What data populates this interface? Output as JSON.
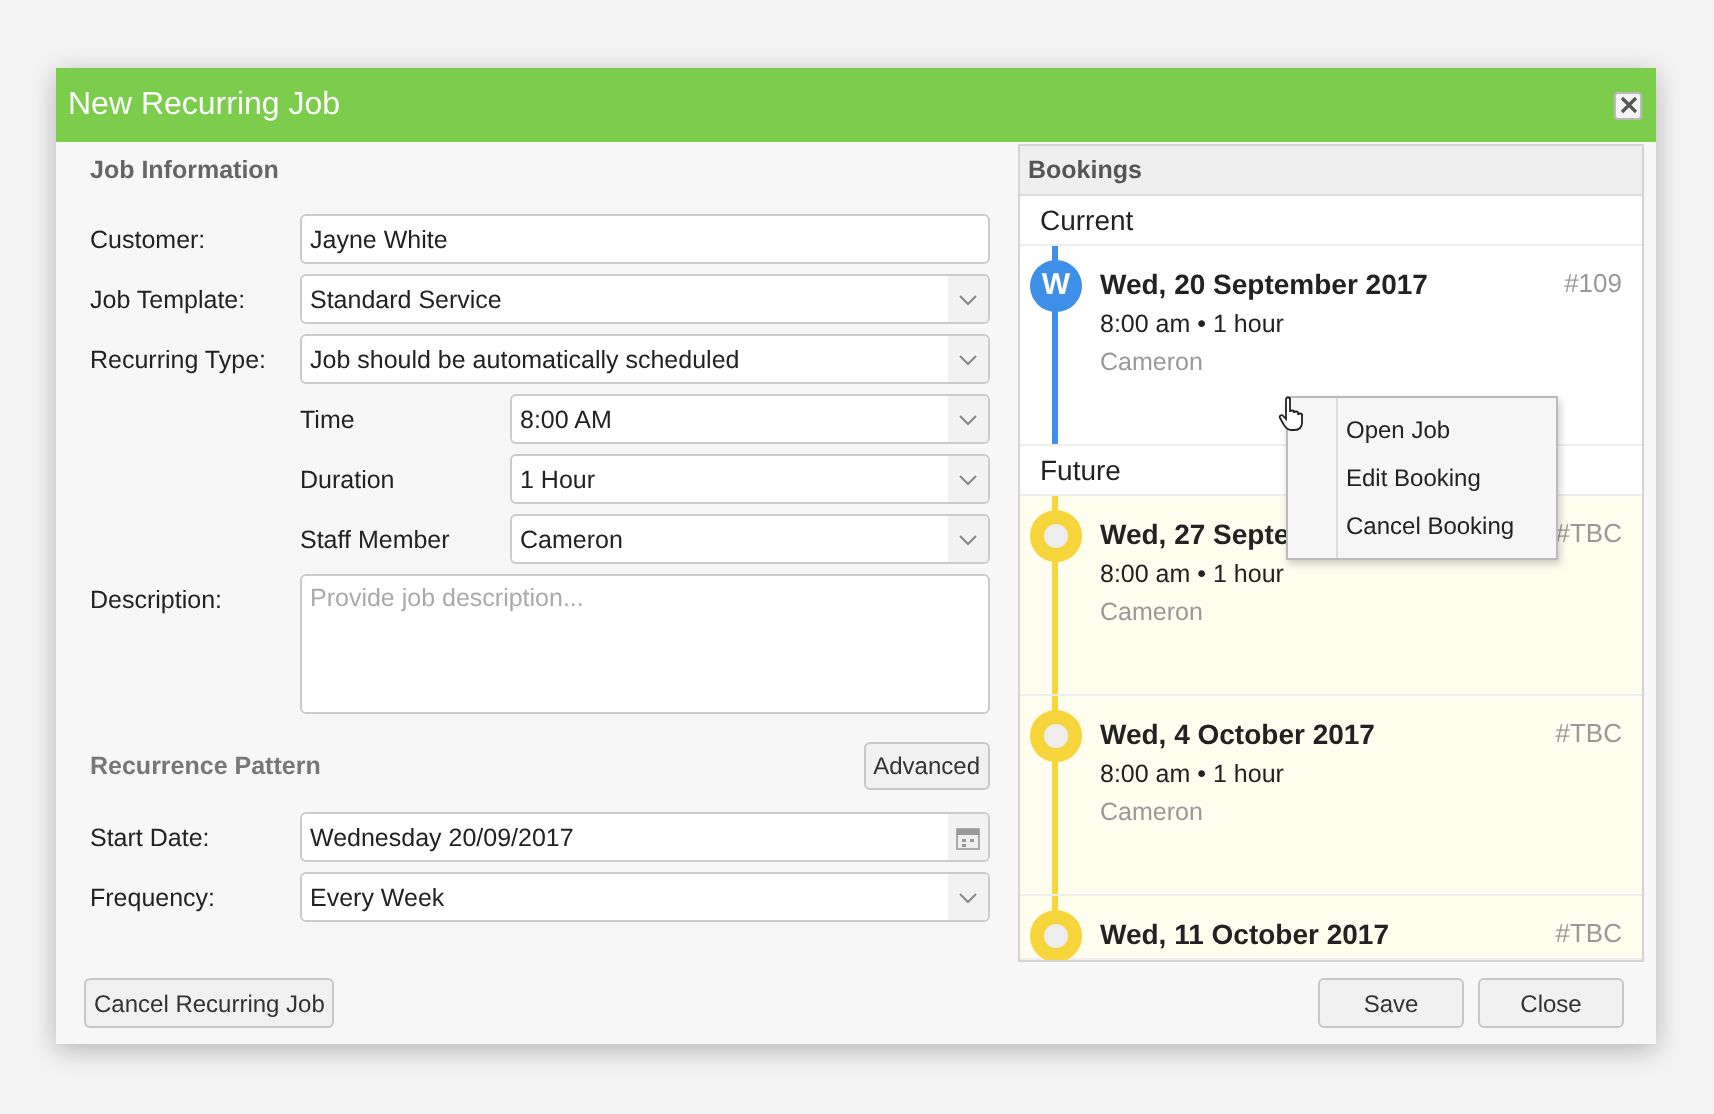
{
  "window": {
    "title": "New Recurring Job"
  },
  "job_information": {
    "heading": "Job Information",
    "fields": [
      {
        "label": "Customer:",
        "kind": "text",
        "value": "Jayne White"
      },
      {
        "label": "Job Template:",
        "kind": "select",
        "value": "Standard Service"
      },
      {
        "label": "Recurring Type:",
        "kind": "select",
        "value": "Job should be automatically scheduled",
        "children": [
          {
            "label": "Time",
            "kind": "select",
            "value": "8:00 AM"
          },
          {
            "label": "Duration",
            "kind": "select",
            "value": "1 Hour"
          },
          {
            "label": "Staff Member",
            "kind": "select",
            "value": "Cameron"
          }
        ]
      },
      {
        "label": "Description:",
        "kind": "textarea",
        "placeholder": "Provide job description..."
      }
    ]
  },
  "recurrence_pattern": {
    "heading": "Recurrence Pattern",
    "advanced_button": "Advanced",
    "fields": [
      {
        "label": "Start Date:",
        "kind": "date",
        "value": "Wednesday 20/09/2017"
      },
      {
        "label": "Frequency:",
        "kind": "select",
        "value": "Every Week"
      }
    ]
  },
  "bookings": {
    "heading": "Bookings",
    "groups": [
      {
        "label": "Current",
        "kind": "current",
        "items": [
          {
            "date": "Wed, 20 September 2017",
            "time": "8:00 am • 1 hour",
            "staff": "Cameron",
            "number": "#109",
            "marker": "W",
            "color": "#3d8fe8"
          }
        ]
      },
      {
        "label": "Future",
        "kind": "future",
        "items": [
          {
            "date": "Wed, 27 Septe",
            "time": "8:00 am • 1 hour",
            "staff": "Cameron",
            "number": "#TBC",
            "color": "#f7d53c"
          },
          {
            "date": "Wed, 4 October 2017",
            "time": "8:00 am • 1 hour",
            "staff": "Cameron",
            "number": "#TBC",
            "color": "#f7d53c"
          },
          {
            "date": "Wed, 11 October 2017",
            "number": "#TBC",
            "color": "#f7d53c"
          }
        ]
      }
    ]
  },
  "context_menu": {
    "items": [
      "Open Job",
      "Edit Booking",
      "Cancel Booking"
    ]
  },
  "buttons": {
    "cancel_recurring": "Cancel Recurring Job",
    "save": "Save",
    "close": "Close"
  }
}
